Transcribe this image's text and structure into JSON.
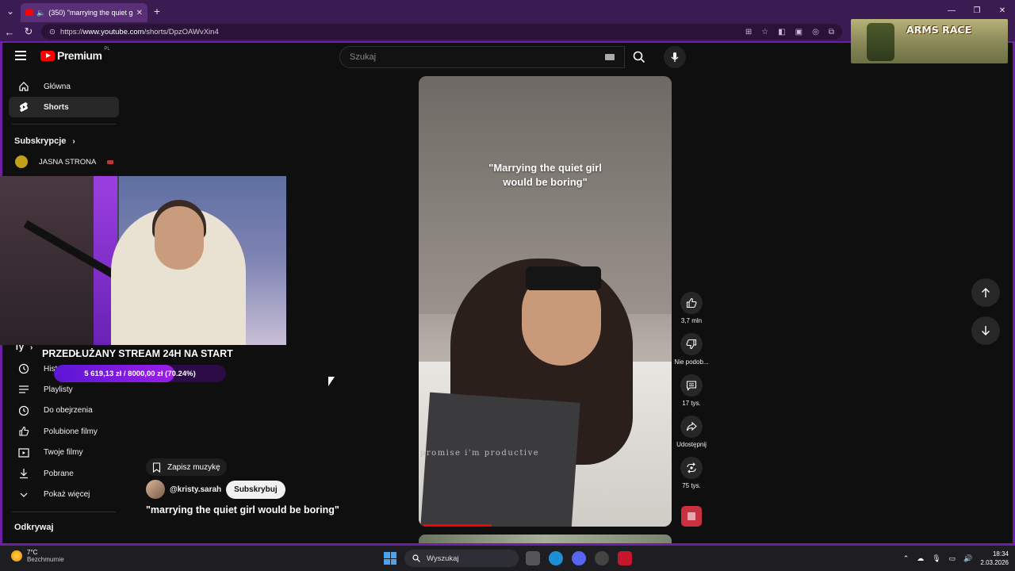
{
  "browser": {
    "tab_title": "(350) \"marrying the quiet girl",
    "url_prefix": "https://",
    "url_host": "www.youtube.com",
    "url_path": "/shorts/DpzOAWvXin4"
  },
  "header": {
    "logo_text": "Premium",
    "logo_region": "PL",
    "search_placeholder": "Szukaj"
  },
  "sidebar": {
    "items": [
      {
        "label": "Główna",
        "icon": "home-icon"
      },
      {
        "label": "Shorts",
        "icon": "shorts-icon"
      }
    ],
    "subscriptions_heading": "Subskrypcje",
    "subscription_channel": "JASNA STRONA",
    "you_heading": "Ty",
    "you_items": [
      {
        "label": "Historia",
        "icon": "history-icon"
      },
      {
        "label": "Playlisty",
        "icon": "playlists-icon"
      },
      {
        "label": "Do obejrzenia",
        "icon": "watch-later-icon"
      },
      {
        "label": "Polubione filmy",
        "icon": "liked-icon"
      },
      {
        "label": "Twoje filmy",
        "icon": "your-videos-icon"
      },
      {
        "label": "Pobrane",
        "icon": "download-icon"
      },
      {
        "label": "Pokaż więcej",
        "icon": "chevron-down-icon"
      }
    ],
    "explore_heading": "Odkrywaj"
  },
  "stream_overlay": {
    "title": "PRZEDŁUŻANY STREAM 24H NA START",
    "goal_text": "5 619,13 zł / 8000,00 zł (70.24%)",
    "goal_fraction": 0.7024
  },
  "short": {
    "caption_line1": "\"Marrying the quiet girl",
    "caption_line2": "would be boring\"",
    "notebook_text": "promise i'm productive",
    "save_music": "Zapisz muzykę",
    "channel_handle": "@kristy.sarah",
    "subscribe_label": "Subskrybuj",
    "title": "\"marrying the quiet girl would be boring\"",
    "progress_fraction": 0.27
  },
  "actions": [
    {
      "name": "like",
      "label": "3,7 mln",
      "icon": "thumbs-up-icon"
    },
    {
      "name": "dislike",
      "label": "Nie podob...",
      "icon": "thumbs-down-icon"
    },
    {
      "name": "comments",
      "label": "17 tys.",
      "icon": "comment-icon"
    },
    {
      "name": "share",
      "label": "Udostępnij",
      "icon": "share-icon"
    },
    {
      "name": "remix",
      "label": "75 tys.",
      "icon": "remix-icon"
    }
  ],
  "overlay_game": {
    "text": "ARMS RACE"
  },
  "taskbar": {
    "temperature": "7°C",
    "weather": "Bezchmurnie",
    "search_label": "Wyszukaj",
    "time": "18:34",
    "date": "2.03.2026"
  },
  "colors": {
    "accent_purple": "#6d1fa8",
    "youtube_red": "#ff0000",
    "background": "#0f0f0f"
  }
}
